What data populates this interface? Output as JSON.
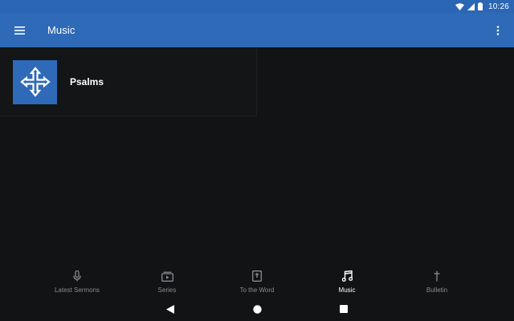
{
  "status": {
    "time": "10:26",
    "icons": [
      "wifi-icon",
      "signal-icon",
      "battery-icon"
    ]
  },
  "app_bar": {
    "title": "Music",
    "menu_icon": "hamburger-menu-icon",
    "overflow_icon": "more-vert-icon",
    "color": "#2f6ab8"
  },
  "content": {
    "items": [
      {
        "title": "Psalms",
        "icon": "cross-arrows-icon"
      }
    ]
  },
  "bottom_nav": {
    "items": [
      {
        "label": "Latest Sermons",
        "icon": "microphone-icon",
        "active": false
      },
      {
        "label": "Series",
        "icon": "series-play-icon",
        "active": false
      },
      {
        "label": "To the Word",
        "icon": "bible-icon",
        "active": false
      },
      {
        "label": "Music",
        "icon": "music-note-icon",
        "active": true
      },
      {
        "label": "Bulletin",
        "icon": "cross-icon",
        "active": false
      }
    ],
    "active_color": "#ffffff",
    "inactive_color": "#8a8c90"
  },
  "system_nav": [
    "back-icon",
    "home-icon",
    "recents-icon"
  ]
}
